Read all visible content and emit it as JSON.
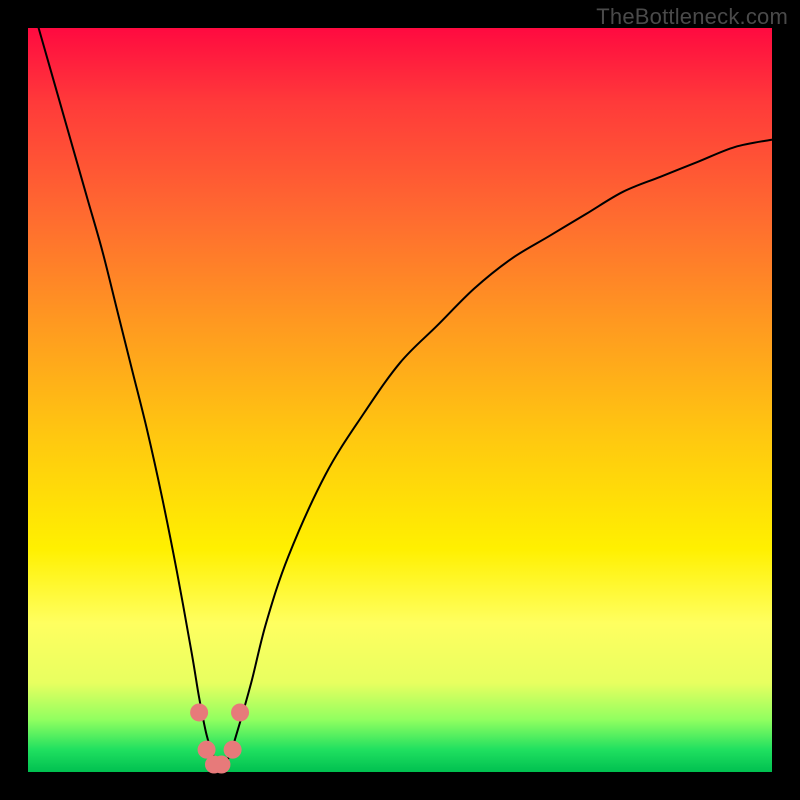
{
  "watermark": "TheBottleneck.com",
  "chart_data": {
    "type": "line",
    "title": "",
    "xlabel": "",
    "ylabel": "",
    "xlim": [
      0,
      100
    ],
    "ylim": [
      0,
      100
    ],
    "curve": {
      "x": [
        0,
        2,
        4,
        6,
        8,
        10,
        12,
        14,
        16,
        18,
        20,
        22,
        23,
        24,
        25,
        26,
        27,
        28,
        30,
        32,
        35,
        40,
        45,
        50,
        55,
        60,
        65,
        70,
        75,
        80,
        85,
        90,
        95,
        100
      ],
      "y": [
        105,
        98,
        91,
        84,
        77,
        70,
        62,
        54,
        46,
        37,
        27,
        16,
        10,
        5,
        2,
        1,
        2,
        5,
        12,
        20,
        29,
        40,
        48,
        55,
        60,
        65,
        69,
        72,
        75,
        78,
        80,
        82,
        84,
        85
      ]
    },
    "markers": [
      {
        "x": 23.0,
        "y": 8
      },
      {
        "x": 24.0,
        "y": 3
      },
      {
        "x": 25.0,
        "y": 1
      },
      {
        "x": 26.0,
        "y": 1
      },
      {
        "x": 27.5,
        "y": 3
      },
      {
        "x": 28.5,
        "y": 8
      }
    ],
    "colors": {
      "gradient_top": "#ff0a40",
      "gradient_bottom": "#00c050",
      "curve": "#000000",
      "markers": "#e77a7a"
    }
  }
}
